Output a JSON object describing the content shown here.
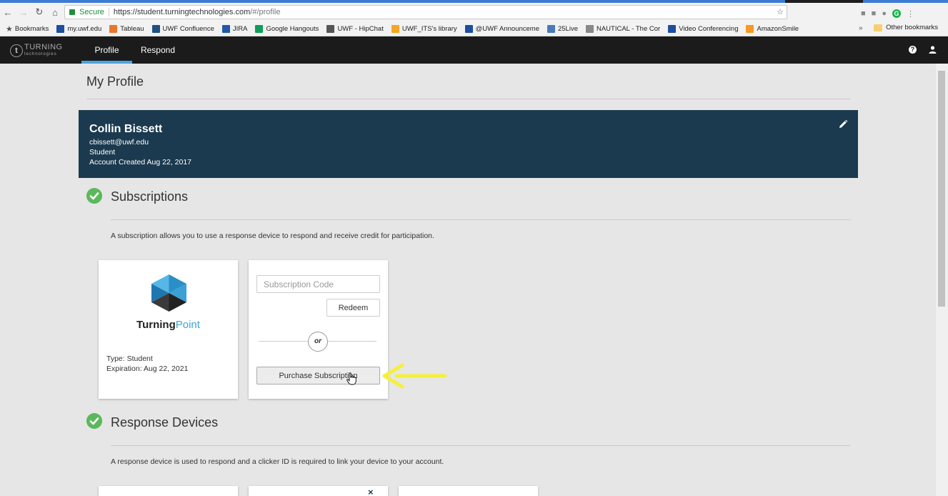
{
  "browser": {
    "secure_label": "Secure",
    "url_host": "https://student.turningtechnologies.com",
    "url_path": "/#/profile",
    "bookmarks": [
      {
        "label": "Bookmarks",
        "icon": "star-icon",
        "color": "#555555"
      },
      {
        "label": "my.uwf.edu",
        "icon": "uwf-icon",
        "color": "#1d4ea0"
      },
      {
        "label": "Tableau",
        "icon": "tableau-icon",
        "color": "#e8762c"
      },
      {
        "label": "UWF Confluence",
        "icon": "confluence-icon",
        "color": "#205081"
      },
      {
        "label": "JIRA",
        "icon": "jira-icon",
        "color": "#2059a8"
      },
      {
        "label": "Google Hangouts",
        "icon": "hangouts-icon",
        "color": "#0f9d58"
      },
      {
        "label": "UWF - HipChat",
        "icon": "hipchat-icon",
        "color": "#555555"
      },
      {
        "label": "UWF_ITS's library",
        "icon": "library-icon",
        "color": "#f5a623"
      },
      {
        "label": "@UWF Announceme",
        "icon": "uwf-icon",
        "color": "#1d4ea0"
      },
      {
        "label": "25Live",
        "icon": "25live-icon",
        "color": "#4a7bb7"
      },
      {
        "label": "NAUTICAL - The Cor",
        "icon": "page-icon",
        "color": "#888888"
      },
      {
        "label": "Video Conferencing",
        "icon": "video-icon",
        "color": "#1d4ea0"
      },
      {
        "label": "AmazonSmile",
        "icon": "amazon-icon",
        "color": "#f59a23"
      }
    ],
    "overflow_label": "»",
    "other_bookmarks": "Other bookmarks"
  },
  "nav": {
    "logo_text": "TURNING",
    "logo_subtext": "technologies",
    "tabs": [
      {
        "label": "Profile",
        "active": true
      },
      {
        "label": "Respond",
        "active": false
      }
    ],
    "help_symbol": "?"
  },
  "page": {
    "title": "My Profile"
  },
  "profile": {
    "name": "Collin Bissett",
    "email": "cbissett@uwf.edu",
    "role": "Student",
    "created": "Account Created Aug 22, 2017"
  },
  "subscriptions": {
    "title": "Subscriptions",
    "description": "A subscription allows you to use a response device to respond and receive credit for participation.",
    "product": {
      "name_bold": "Turning",
      "name_light": "Point",
      "type": "Type: Student",
      "expiration": "Expiration: Aug 22, 2021"
    },
    "code_placeholder": "Subscription Code",
    "redeem_label": "Redeem",
    "or_label": "or",
    "purchase_label": "Purchase Subscription"
  },
  "devices": {
    "title": "Response Devices",
    "description": "A response device is used to respond and a clicker ID is required to link your device to your account.",
    "close_symbol": "×"
  },
  "colors": {
    "profile_banner": "#1b3a4f",
    "accent": "#4aa3df",
    "check": "#5cb85c",
    "highlight_arrow": "#f5f03a"
  }
}
